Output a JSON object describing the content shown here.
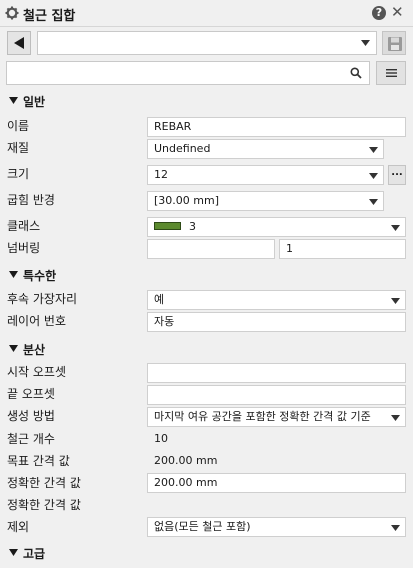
{
  "title": "철근 집합",
  "help_glyph": "?",
  "close_glyph": "✕",
  "top_combo_value": "",
  "search": {
    "value": "",
    "placeholder": ""
  },
  "sections": {
    "general": "일반",
    "specialty": "특수한",
    "distribution": "분산",
    "advanced": "고급"
  },
  "general": {
    "name_label": "이름",
    "name_value": "REBAR",
    "material_label": "재질",
    "material_value": "Undefined",
    "size_label": "크기",
    "size_value": "12",
    "ellipsis": "...",
    "bend_radius_label": "굽힘 반경",
    "bend_radius_value": "[30.00 mm]",
    "class_label": "클래스",
    "class_value": "3",
    "class_color": "#5c8a2e",
    "numbering_label": "넘버링",
    "numbering_prefix": "",
    "numbering_start": "1"
  },
  "specialty": {
    "subsequent_edge_label": "후속 가장자리",
    "subsequent_edge_value": "예",
    "layer_number_label": "레이어 번호",
    "layer_number_value": "자동"
  },
  "distribution": {
    "start_offset_label": "시작 오프셋",
    "start_offset_value": "",
    "end_offset_label": "끝 오프셋",
    "end_offset_value": "",
    "method_label": "생성 방법",
    "method_value": "마지막 여유 공간을 포함한 정확한 간격 값 기준",
    "count_label": "철근 개수",
    "count_value": "10",
    "target_spacing_label": "목표 간격 값",
    "target_spacing_value": "200.00 mm",
    "exact_spacing_label": "정확한 간격 값",
    "exact_spacing_value": "200.00 mm",
    "exact_spacings_label": "정확한 간격 값",
    "exact_spacings_value": "",
    "exclude_label": "제외",
    "exclude_value": "없음(모든 철근 포함)"
  }
}
